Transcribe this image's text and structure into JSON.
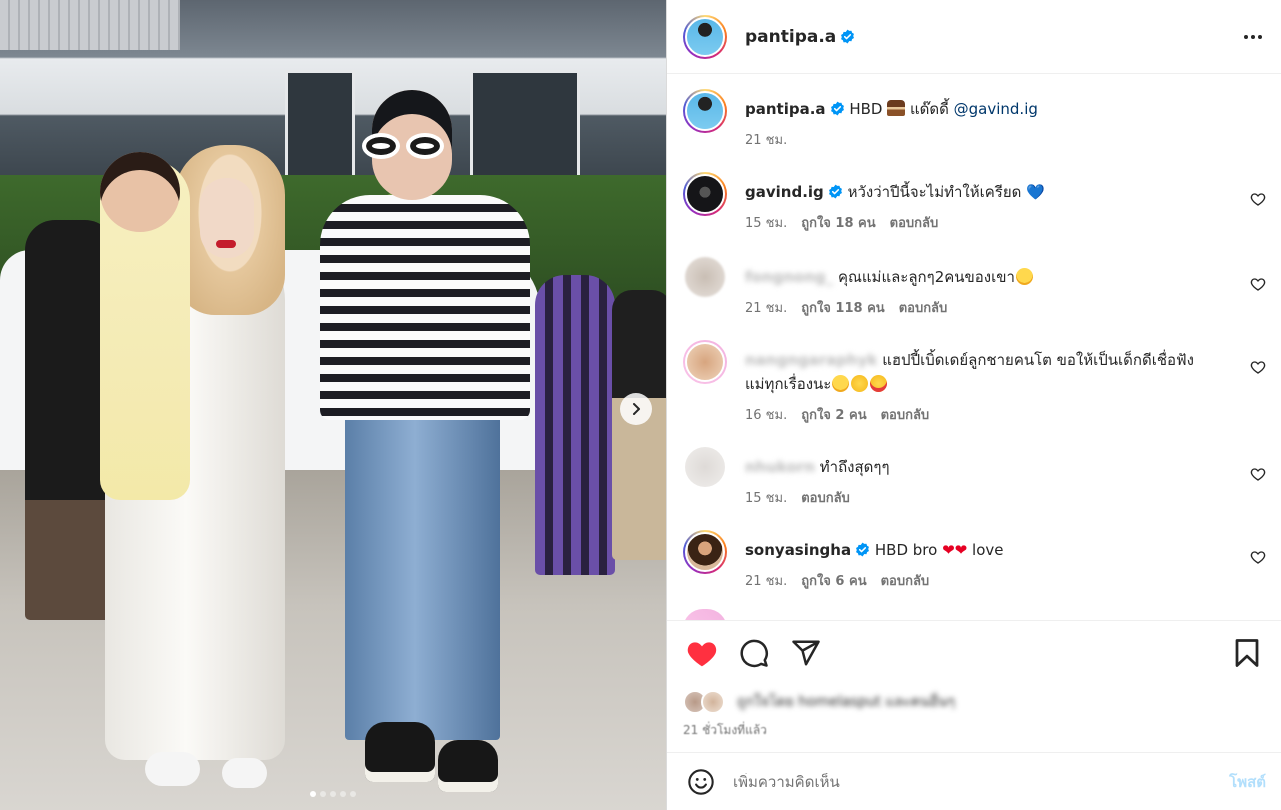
{
  "post": {
    "username": "pantipa.a",
    "more_label": "More options"
  },
  "media": {
    "slides_count": 5,
    "active_slide": 1
  },
  "caption": {
    "username": "pantipa.a",
    "text_prefix": "HBD ",
    "text_after_emoji": " แด๊ดดี้ ",
    "mention": "@gavind.ig",
    "time": "21 ชม."
  },
  "comments": [
    {
      "username": "gavind.ig",
      "verified": true,
      "text": "หวังว่าปีนี้จะไม่ทำให้เครียด",
      "trailing": "💙",
      "time": "15 ชม.",
      "likes": "ถูกใจ 18 คน",
      "reply": "ตอบกลับ"
    },
    {
      "username": "fongnong_",
      "blurred": true,
      "text": "คุณแม่และลูกๆ2คนของเขา",
      "time": "21 ชม.",
      "likes": "ถูกใจ 118 คน",
      "reply": "ตอบกลับ"
    },
    {
      "username": "nangngaraphyk",
      "blurred": true,
      "text": "แฮปปี้เบิ้ดเดย์ลูกชายคนโต ขอให้เป็นเด็กดีเชื่อฟัง",
      "text2": "แม่ทุกเรื่องนะ",
      "time": "16 ชม.",
      "likes": "ถูกใจ 2 คน",
      "reply": "ตอบกลับ"
    },
    {
      "username": "nhukorn",
      "blurred": true,
      "text": "ทำถึงสุดๆๆ",
      "time": "15 ชม.",
      "reply": "ตอบกลับ"
    },
    {
      "username": "sonyasingha",
      "verified": true,
      "text": "HBD bro",
      "text_after": "love",
      "time": "21 ชม.",
      "likes": "ถูกใจ 6 คน",
      "reply": "ตอบกลับ"
    }
  ],
  "likes_summary": {
    "text": "ถูกใจโดย homelasput และคนอื่นๆ"
  },
  "post_time": "21 ชั่วโมงที่แล้ว",
  "add_comment": {
    "placeholder": "เพิ่มความคิดเห็น",
    "post_label": "โพสต์"
  },
  "colors": {
    "like_active": "#ff3040",
    "verified": "#0095f6",
    "mention": "#00376b",
    "post_button_disabled": "#b2dffc"
  }
}
